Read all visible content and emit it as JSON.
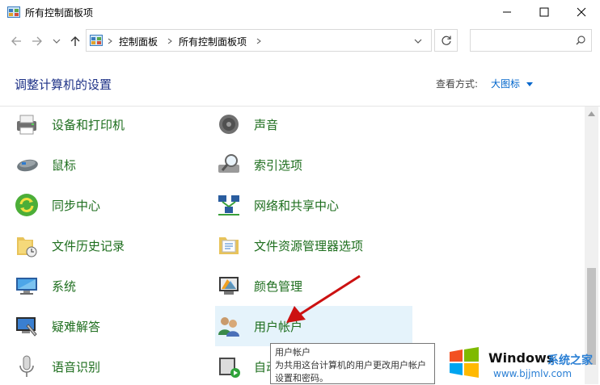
{
  "window": {
    "title": "所有控制面板项"
  },
  "breadcrumb": {
    "items": [
      "控制面板",
      "所有控制面板项"
    ]
  },
  "search": {
    "placeholder": ""
  },
  "header": {
    "heading": "调整计算机的设置",
    "view_label": "查看方式:",
    "view_value": "大图标"
  },
  "left_items": [
    {
      "label": "设备和打印机",
      "icon": "printer-icon"
    },
    {
      "label": "鼠标",
      "icon": "mouse-icon"
    },
    {
      "label": "同步中心",
      "icon": "sync-icon"
    },
    {
      "label": "文件历史记录",
      "icon": "folder-history-icon"
    },
    {
      "label": "系统",
      "icon": "computer-icon"
    },
    {
      "label": "疑难解答",
      "icon": "troubleshoot-icon"
    },
    {
      "label": "语音识别",
      "icon": "microphone-icon"
    }
  ],
  "right_items": [
    {
      "label": "声音",
      "icon": "speaker-icon"
    },
    {
      "label": "索引选项",
      "icon": "index-search-icon"
    },
    {
      "label": "网络和共享中心",
      "icon": "network-icon"
    },
    {
      "label": "文件资源管理器选项",
      "icon": "folder-options-icon"
    },
    {
      "label": "颜色管理",
      "icon": "color-management-icon"
    },
    {
      "label": "用户帐户",
      "icon": "user-accounts-icon"
    },
    {
      "label": "自动播放",
      "icon": "autoplay-icon"
    }
  ],
  "tooltip": {
    "title": "用户帐户",
    "body": "为共用这台计算机的用户更改用户帐户设置和密码。"
  },
  "watermark": {
    "brand": "Windows",
    "cn": "系统之家",
    "url": "www.bjjmlv.com"
  },
  "colors": {
    "link_green": "#1e6e1e",
    "heading_blue": "#1e3287",
    "accent_blue": "#0066cc",
    "hover_bg": "#e5f3fb",
    "arrow_red": "#cc1111"
  }
}
